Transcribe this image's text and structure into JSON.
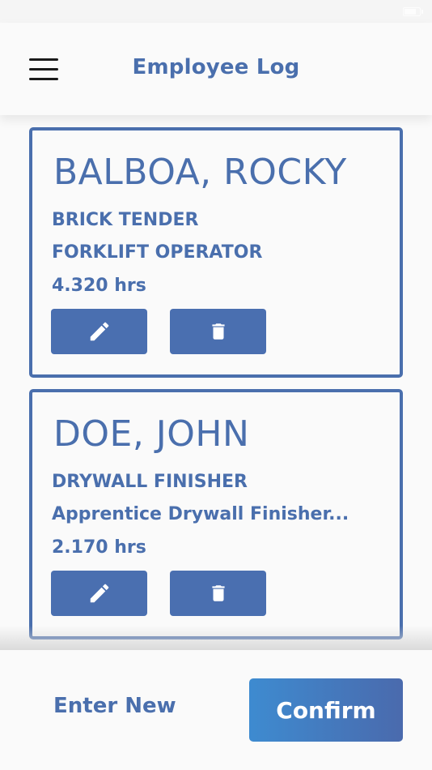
{
  "header": {
    "title": "Employee Log"
  },
  "employees": [
    {
      "name": "BALBOA, ROCKY",
      "trade": "BRICK TENDER",
      "classification": "FORKLIFT OPERATOR",
      "hours": "4.320 hrs"
    },
    {
      "name": "DOE, JOHN",
      "trade": "DRYWALL FINISHER",
      "classification": "Apprentice Drywall Finisher...",
      "hours": "2.170 hrs"
    }
  ],
  "footer": {
    "enter_new_label": "Enter New",
    "confirm_label": "Confirm"
  },
  "icons": {
    "menu": "hamburger-menu-icon",
    "edit": "pencil-icon",
    "delete": "trash-icon"
  },
  "colors": {
    "accent": "#4a6fad",
    "button": "#4a6fb0",
    "confirm_start": "#3e8bd0",
    "confirm_end": "#4a6aad"
  }
}
